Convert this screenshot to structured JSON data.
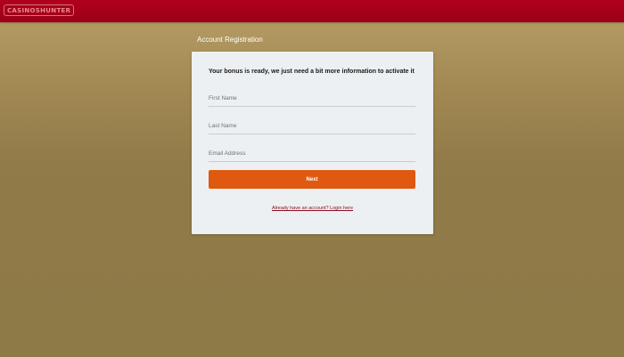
{
  "header": {
    "logo_text": "CASINOSHUNTER"
  },
  "page": {
    "title": "Account Registration"
  },
  "form": {
    "heading": "Your bonus is ready, we just need a bit more information to activate it",
    "fields": [
      {
        "placeholder": "First Name",
        "value": ""
      },
      {
        "placeholder": "Last Name",
        "value": ""
      },
      {
        "placeholder": "Email Address",
        "value": ""
      }
    ],
    "next_label": "Next",
    "login_link": "Already have an account? Login here"
  },
  "colors": {
    "header_bg": "#b0001d",
    "background_top": "#b9a067",
    "background_bottom": "#8d7a47",
    "card_bg": "#edf0f2",
    "button_bg": "#df5a10",
    "link_color": "#8a1020"
  }
}
